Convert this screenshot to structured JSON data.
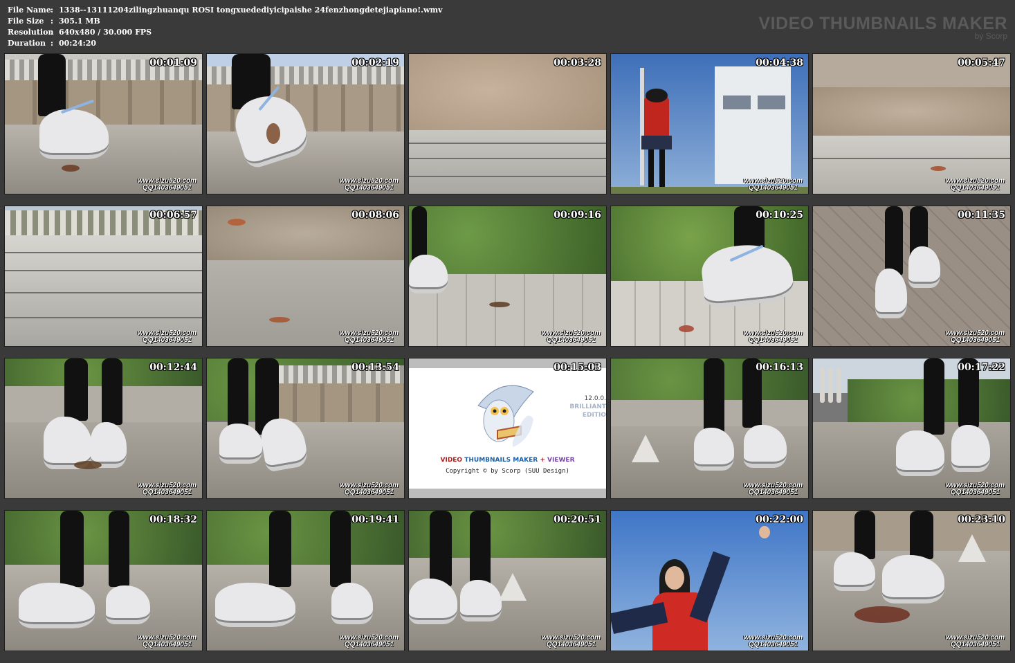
{
  "info": {
    "rows": [
      {
        "key": "File Name",
        "sep": ":",
        "value": "1338--13111204zilingzhuanqu ROSI tongxuedediyicipaishe 24fenzhongdetejiapiano!.wmv"
      },
      {
        "key": "File Size",
        "sep": ":",
        "value": "305.1 MB"
      },
      {
        "key": "Resolution",
        "sep": ":",
        "value": "640x480 / 30.000 FPS"
      },
      {
        "key": "Duration",
        "sep": ":",
        "value": "00:24:20"
      }
    ]
  },
  "brand": {
    "title": "VIDEO THUMBNAILS MAKER",
    "by": "by Scorp"
  },
  "watermark": {
    "line1": "www.sizu520.com",
    "line2": "QQ1403649051"
  },
  "splash": {
    "version": "12.0.0.",
    "edition_1": "BRILLIANT",
    "edition_2": "EDITIO",
    "title_prefix": "VIDEO",
    "title_mid": "THUMBNAILS MAKER",
    "title_plus": "+",
    "title_suffix": "VIEWER",
    "copyright": "Copyright © by Scorp (SUU Design)"
  },
  "thumbnails": [
    {
      "time": "00:01:09"
    },
    {
      "time": "00:02:19"
    },
    {
      "time": "00:03:28"
    },
    {
      "time": "00:04:38"
    },
    {
      "time": "00:05:47"
    },
    {
      "time": "00:06:57"
    },
    {
      "time": "00:08:06"
    },
    {
      "time": "00:09:16"
    },
    {
      "time": "00:10:25"
    },
    {
      "time": "00:11:35"
    },
    {
      "time": "00:12:44"
    },
    {
      "time": "00:13:54"
    },
    {
      "time": "00:15:03"
    },
    {
      "time": "00:16:13"
    },
    {
      "time": "00:17:22"
    },
    {
      "time": "00:18:32"
    },
    {
      "time": "00:19:41"
    },
    {
      "time": "00:20:51"
    },
    {
      "time": "00:22:00"
    },
    {
      "time": "00:23:10"
    }
  ]
}
